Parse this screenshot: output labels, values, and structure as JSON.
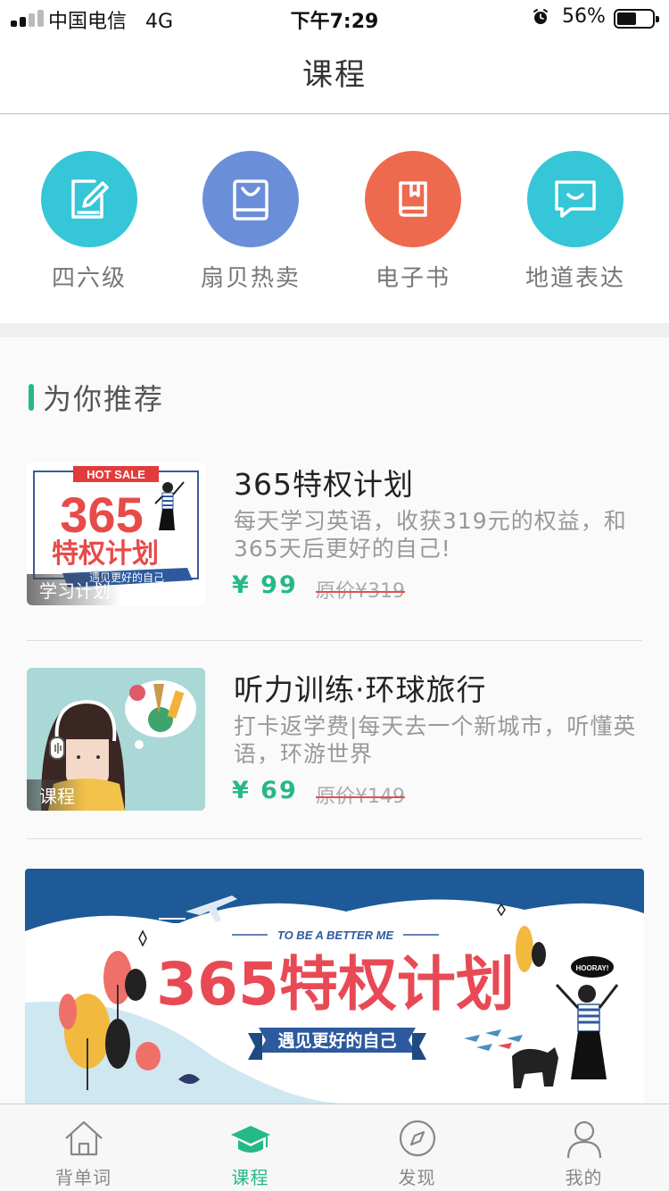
{
  "status_bar": {
    "carrier": "中国电信",
    "network": "4G",
    "time": "下午7:29",
    "battery": "56%",
    "battery_level": 0.56
  },
  "nav": {
    "title": "课程"
  },
  "categories": [
    {
      "label": "四六级",
      "icon": "pencil-note-icon",
      "color": "#35c6d8"
    },
    {
      "label": "扇贝热卖",
      "icon": "shopping-bag-icon",
      "color": "#6a8fd8"
    },
    {
      "label": "电子书",
      "icon": "book-icon",
      "color": "#ee6a4f"
    },
    {
      "label": "地道表达",
      "icon": "chat-bubble-icon",
      "color": "#35c6d8"
    }
  ],
  "recommend": {
    "title": "为你推荐",
    "courses": [
      {
        "name": "365特权计划",
        "desc": "每天学习英语，收获319元的权益，和365天后更好的自己!",
        "price": "¥ 99",
        "original_price": "原价¥319",
        "tag": "学习计划",
        "thumb": {
          "hot": "HOT SALE",
          "big": "365",
          "sub": "特权计划",
          "ribbon": "遇见更好的自己"
        }
      },
      {
        "name": "听力训练·环球旅行",
        "desc": "打卡返学费|每天去一个新城市，听懂英语，环游世界",
        "price": "¥ 69",
        "original_price": "原价¥149",
        "tag": "课程"
      }
    ],
    "banner": {
      "tagline": "TO BE A BETTER ME",
      "title": "365特权计划",
      "ribbon": "遇见更好的自己",
      "hooray": "HOORAY!"
    }
  },
  "tabbar": [
    {
      "label": "背单词",
      "icon": "home-icon",
      "active": false
    },
    {
      "label": "课程",
      "icon": "graduation-cap-icon",
      "active": true
    },
    {
      "label": "发现",
      "icon": "compass-icon",
      "active": false
    },
    {
      "label": "我的",
      "icon": "user-icon",
      "active": false
    }
  ],
  "colors": {
    "accent": "#26b889",
    "price": "#26b889",
    "hot": "#e23b3b",
    "banner_sky": "#1d5a97"
  }
}
